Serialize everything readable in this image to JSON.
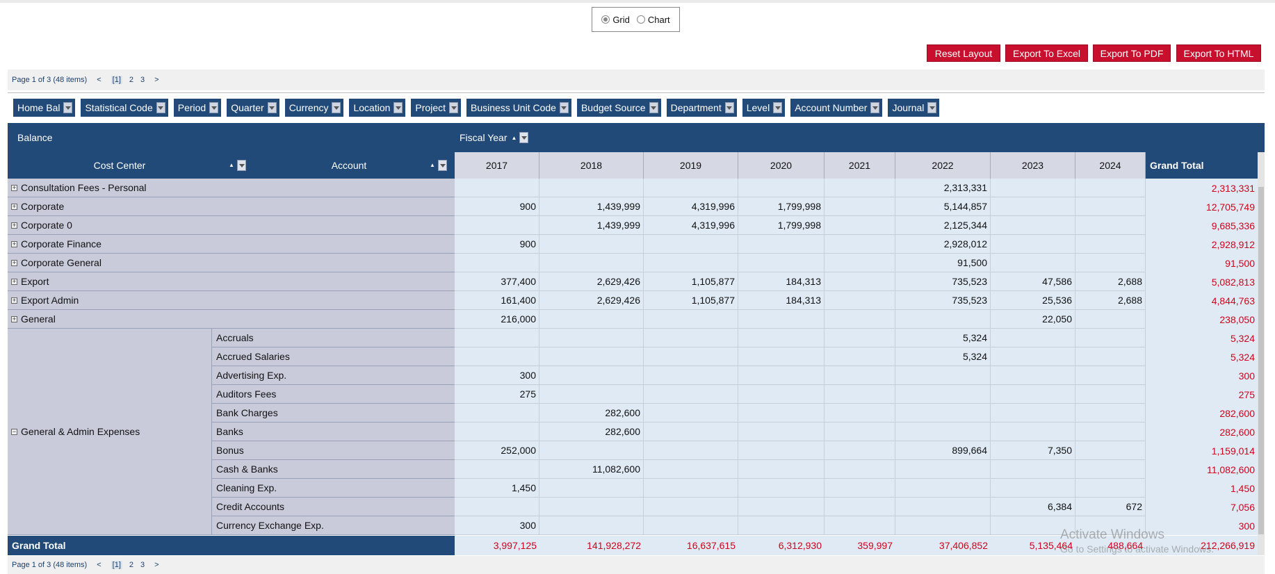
{
  "view_mode": {
    "options": [
      {
        "label": "Grid",
        "selected": true
      },
      {
        "label": "Chart",
        "selected": false
      }
    ]
  },
  "toolbar": {
    "reset": "Reset Layout",
    "excel": "Export To Excel",
    "pdf": "Export To PDF",
    "html": "Export To HTML"
  },
  "pager": {
    "info": "Page 1 of 3 (48 items)",
    "prev": "<",
    "pages": [
      "[1]",
      "2",
      "3"
    ],
    "next": ">"
  },
  "filters": [
    "Home Bal",
    "Statistical Code",
    "Period",
    "Quarter",
    "Currency",
    "Location",
    "Project",
    "Business Unit Code",
    "Budget Source",
    "Department",
    "Level",
    "Account Number",
    "Journal"
  ],
  "grid": {
    "data_field": "Balance",
    "column_field": "Fiscal Year",
    "row_fields": [
      "Cost Center",
      "Account"
    ],
    "years": [
      "2017",
      "2018",
      "2019",
      "2020",
      "2021",
      "2022",
      "2023",
      "2024"
    ],
    "grand_total_label": "Grand Total",
    "rows": [
      {
        "cost_center": "Consultation Fees - Personal",
        "expanded": false,
        "values": [
          "",
          "",
          "",
          "",
          "",
          "2,313,331",
          "",
          ""
        ],
        "total": "2,313,331"
      },
      {
        "cost_center": "Corporate",
        "expanded": false,
        "values": [
          "900",
          "1,439,999",
          "4,319,996",
          "1,799,998",
          "",
          "5,144,857",
          "",
          ""
        ],
        "total": "12,705,749"
      },
      {
        "cost_center": "Corporate 0",
        "expanded": false,
        "values": [
          "",
          "1,439,999",
          "4,319,996",
          "1,799,998",
          "",
          "2,125,344",
          "",
          ""
        ],
        "total": "9,685,336"
      },
      {
        "cost_center": "Corporate Finance",
        "expanded": false,
        "values": [
          "900",
          "",
          "",
          "",
          "",
          "2,928,012",
          "",
          ""
        ],
        "total": "2,928,912"
      },
      {
        "cost_center": "Corporate General",
        "expanded": false,
        "values": [
          "",
          "",
          "",
          "",
          "",
          "91,500",
          "",
          ""
        ],
        "total": "91,500"
      },
      {
        "cost_center": "Export",
        "expanded": false,
        "values": [
          "377,400",
          "2,629,426",
          "1,105,877",
          "184,313",
          "",
          "735,523",
          "47,586",
          "2,688"
        ],
        "total": "5,082,813"
      },
      {
        "cost_center": "Export Admin",
        "expanded": false,
        "values": [
          "161,400",
          "2,629,426",
          "1,105,877",
          "184,313",
          "",
          "735,523",
          "25,536",
          "2,688"
        ],
        "total": "4,844,763"
      },
      {
        "cost_center": "General",
        "expanded": false,
        "values": [
          "216,000",
          "",
          "",
          "",
          "",
          "",
          "22,050",
          ""
        ],
        "total": "238,050"
      }
    ],
    "group": {
      "cost_center": "General & Admin Expenses",
      "expanded": true,
      "accounts": [
        {
          "name": "Accruals",
          "values": [
            "",
            "",
            "",
            "",
            "",
            "5,324",
            "",
            ""
          ],
          "total": "5,324"
        },
        {
          "name": "Accrued Salaries",
          "values": [
            "",
            "",
            "",
            "",
            "",
            "5,324",
            "",
            ""
          ],
          "total": "5,324"
        },
        {
          "name": "Advertising Exp.",
          "values": [
            "300",
            "",
            "",
            "",
            "",
            "",
            "",
            ""
          ],
          "total": "300"
        },
        {
          "name": "Auditors Fees",
          "values": [
            "275",
            "",
            "",
            "",
            "",
            "",
            "",
            ""
          ],
          "total": "275"
        },
        {
          "name": "Bank Charges",
          "values": [
            "",
            "282,600",
            "",
            "",
            "",
            "",
            "",
            ""
          ],
          "total": "282,600"
        },
        {
          "name": "Banks",
          "values": [
            "",
            "282,600",
            "",
            "",
            "",
            "",
            "",
            ""
          ],
          "total": "282,600"
        },
        {
          "name": "Bonus",
          "values": [
            "252,000",
            "",
            "",
            "",
            "",
            "899,664",
            "7,350",
            ""
          ],
          "total": "1,159,014"
        },
        {
          "name": "Cash & Banks",
          "values": [
            "",
            "11,082,600",
            "",
            "",
            "",
            "",
            "",
            ""
          ],
          "total": "11,082,600"
        },
        {
          "name": "Cleaning Exp.",
          "values": [
            "1,450",
            "",
            "",
            "",
            "",
            "",
            "",
            ""
          ],
          "total": "1,450"
        },
        {
          "name": "Credit Accounts",
          "values": [
            "",
            "",
            "",
            "",
            "",
            "",
            "6,384",
            "672"
          ],
          "total": "7,056"
        },
        {
          "name": "Currency Exchange Exp.",
          "values": [
            "300",
            "",
            "",
            "",
            "",
            "",
            "",
            ""
          ],
          "total": "300"
        }
      ]
    },
    "grand_totals": [
      "3,997,125",
      "141,928,272",
      "16,637,615",
      "6,312,930",
      "359,997",
      "37,406,852",
      "5,135,464",
      "488,664"
    ],
    "grand_total_all": "212,266,919"
  },
  "watermark": {
    "line1": "Activate Windows",
    "line2": "Go to Settings to activate Windows."
  },
  "colors": {
    "header": "#224a78",
    "button": "#c8102e",
    "total_text": "#d0021b",
    "cell_bg": "#dfeaf4",
    "row_header_bg": "#c9cbdb"
  }
}
